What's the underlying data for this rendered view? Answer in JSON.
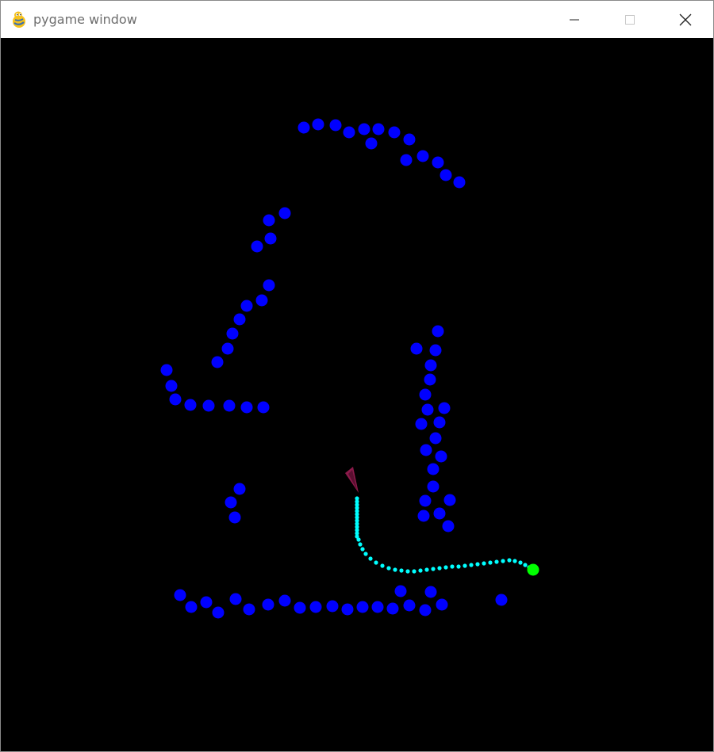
{
  "window": {
    "title": "pygame window",
    "app_icon": "pygame-snake-icon",
    "controls": [
      "minimize-icon",
      "maximize-icon",
      "close-icon"
    ]
  },
  "scene": {
    "background": "#000000",
    "obstacle_color": "#0000ff",
    "path_color": "#00ffff",
    "goal_color": "#00ff00",
    "agent_color": "#8b1a4a"
  }
}
